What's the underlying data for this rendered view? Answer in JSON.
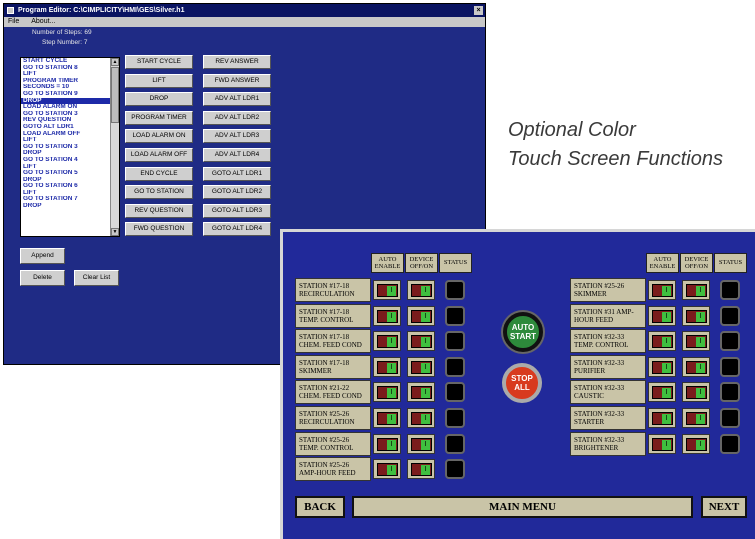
{
  "program_editor": {
    "title": "Program Editor: C:\\CIMPLICITY\\HMI\\GES\\Silver.h1",
    "close_glyph": "×",
    "menu": [
      "File",
      "About..."
    ],
    "number_of_steps": "Number of Steps:  69",
    "step_number": "Step Number:  7",
    "steps": [
      "START CYCLE",
      "GO TO STATION 8",
      "LIFT",
      "PROGRAM TIMER",
      "SECONDS = 10",
      "GO TO STATION 9",
      "DROP",
      "LOAD ALARM ON",
      "GO TO STATION 3",
      "REV QUESTION",
      "GOTO ALT LDR1",
      "LOAD ALARM OFF",
      "LIFT",
      "GO TO STATION 3",
      "DROP",
      "GO TO STATION 4",
      "LIFT",
      "GO TO STATION 5",
      "DROP",
      "GO TO STATION 6",
      "LIFT",
      "GO TO STATION 7",
      "DROP"
    ],
    "selected_index": 6,
    "buttons_col1": [
      "START CYCLE",
      "LIFT",
      "DROP",
      "PROGRAM TIMER",
      "LOAD ALARM ON",
      "LOAD ALARM OFF",
      "END CYCLE",
      "GO TO STATION",
      "REV QUESTION",
      "FWD QUESTION"
    ],
    "buttons_col2": [
      "REV ANSWER",
      "FWD ANSWER",
      "ADV ALT LDR1",
      "ADV ALT LDR2",
      "ADV ALT LDR3",
      "ADV ALT LDR4",
      "GOTO ALT LDR1",
      "GOTO ALT LDR2",
      "GOTO ALT LDR3",
      "GOTO ALT LDR4"
    ],
    "append_label": "Append",
    "delete_label": "Delete",
    "clear_label": "Clear List"
  },
  "caption": {
    "line1": "Optional Color",
    "line2": "Touch Screen Functions"
  },
  "touch_screen": {
    "header_auto": "AUTO ENABLE",
    "header_device": "DEVICE OFF/ON",
    "header_status": "STATUS",
    "switch_glyph": "I",
    "left_stations": [
      "STATION #17-18 RECIRCULATION",
      "STATION #17-18 TEMP. CONTROL",
      "STATION #17-18 CHEM. FEED COND",
      "STATION #17-18 SKIMMER",
      "STATION #21-22 CHEM. FEED COND",
      "STATION #25-26 RECIRCULATION",
      "STATION #25-26 TEMP. CONTROL",
      "STATION #25-26 AMP-HOUR FEED"
    ],
    "right_stations": [
      "STATION #25-26 SKIMMER",
      "STATION #31 AMP-HOUR FEED",
      "STATION #32-33 TEMP. CONTROL",
      "STATION #32-33 PURIFIER",
      "STATION #32-33 CAUSTIC",
      "STATION #32-33 STARTER",
      "STATION #32-33 BRIGHTENER"
    ],
    "auto_start_label": "AUTO START",
    "stop_all_label": "STOP ALL",
    "back_label": "BACK",
    "main_menu_label": "MAIN MENU",
    "next_label": "NEXT",
    "colors": {
      "panel": "#21299a",
      "tan": "#c9c4a7",
      "green": "#2d8a3b",
      "red": "#d83a1e"
    }
  }
}
